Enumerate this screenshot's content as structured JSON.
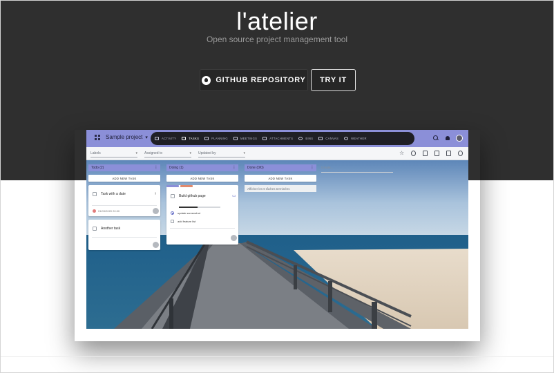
{
  "hero": {
    "title": "l'atelier",
    "subtitle": "Open source project management tool"
  },
  "buttons": {
    "github_label": "GITHUB REPOSITORY",
    "try_label": "TRY IT"
  },
  "app": {
    "project_label": "Sample project",
    "nav": [
      {
        "label": "ACTIVITY",
        "icon": "activity-icon"
      },
      {
        "label": "TASKS",
        "icon": "tasks-icon",
        "active": true
      },
      {
        "label": "PLANNING",
        "icon": "planning-icon"
      },
      {
        "label": "MEETINGS",
        "icon": "meetings-icon"
      },
      {
        "label": "ATTACHMENTS",
        "icon": "attachments-icon"
      },
      {
        "label": "BINS",
        "icon": "bins-icon"
      },
      {
        "label": "CANVAS",
        "icon": "canvas-icon"
      },
      {
        "label": "WEATHER",
        "icon": "weather-icon"
      }
    ],
    "filters": {
      "labels": "Labels",
      "assigned": "Assigned to",
      "updated": "Updated by"
    },
    "columns": {
      "todo": {
        "header": "Todo (2)",
        "add": "ADD NEW TASK",
        "card1_title": "Task with a date",
        "card1_date": "01/03/2020 20:00",
        "card2_title": "Another task"
      },
      "doing": {
        "header": "Doing (1)",
        "add": "ADD NEW TASK",
        "card_title": "Build github page",
        "item1": "update screenshot",
        "item2": "add feature list",
        "progress": 0.45
      },
      "done": {
        "header": "Done (0/0)",
        "add": "ADD NEW TASK",
        "info": "Afficher les 0 tâches terminées"
      },
      "new_placeholder": "Create..."
    }
  },
  "colors": {
    "hero_bg": "#2f2f2f",
    "accent": "#8b8fd8",
    "nav_bg": "#1f1f25"
  }
}
